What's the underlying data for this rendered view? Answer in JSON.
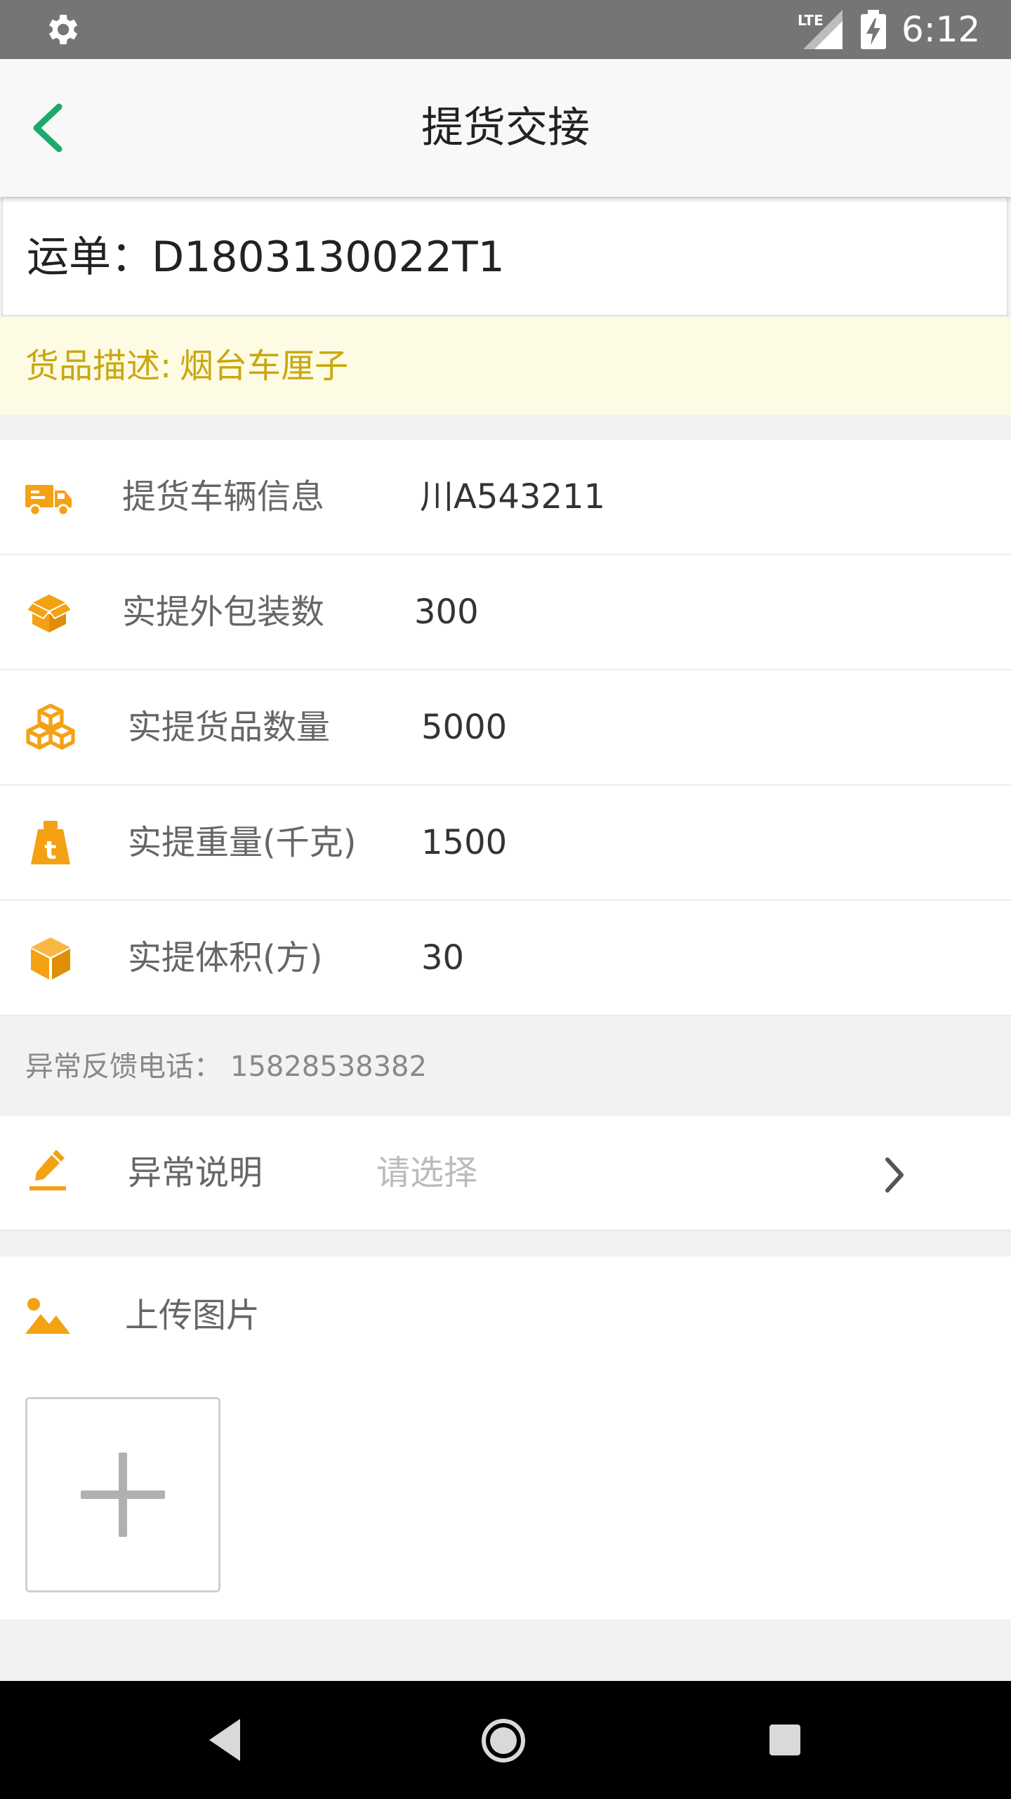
{
  "status_bar": {
    "time": "6:12",
    "icons": [
      "gear-icon",
      "lte-signal-icon",
      "battery-charging-icon"
    ]
  },
  "app_bar": {
    "title": "提货交接",
    "accent_color": "#1aaa6e"
  },
  "waybill": {
    "label": "运单：",
    "number": "D1803130022T1"
  },
  "goods": {
    "label": "货品描述:",
    "value": "烟台车厘子",
    "color": "#c9a810",
    "background": "#fdfbe3"
  },
  "rows": [
    {
      "icon": "truck-icon",
      "label": "提货车辆信息",
      "value": "川A543211"
    },
    {
      "icon": "package-icon",
      "label": "实提外包装数",
      "value": "300"
    },
    {
      "icon": "boxes-icon",
      "label": "实提货品数量",
      "value": "5000"
    },
    {
      "icon": "weight-icon",
      "label": "实提重量(千克)",
      "value": "1500"
    },
    {
      "icon": "cube-icon",
      "label": "实提体积(方)",
      "value": "30"
    }
  ],
  "icon_color": "#f5a114",
  "hotline": {
    "label": "异常反馈电话：",
    "number": "15828538382"
  },
  "exception": {
    "icon": "pencil-icon",
    "label": "异常说明",
    "placeholder": "请选择"
  },
  "upload": {
    "icon": "image-icon",
    "label": "上传图片"
  },
  "nav_bar": {
    "icons": [
      "nav-back-icon",
      "nav-home-icon",
      "nav-recents-icon"
    ]
  }
}
